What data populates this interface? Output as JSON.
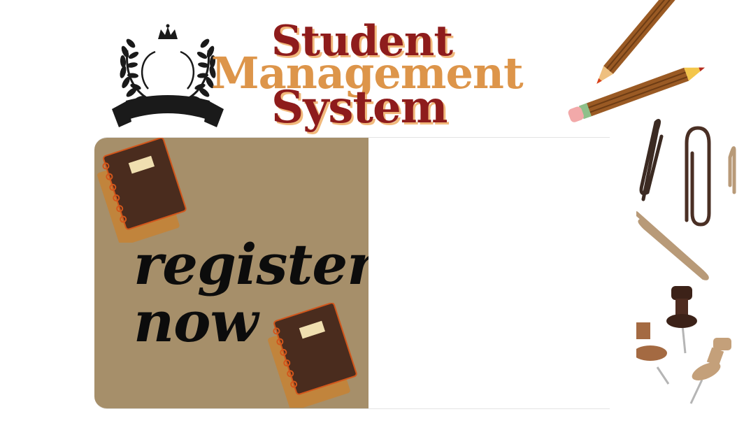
{
  "header": {
    "title_line1": "Student",
    "title_line2": "Management",
    "title_line3": "System"
  },
  "banner": {
    "line1": "register",
    "line2": "now"
  },
  "colors": {
    "title_dark": "#8e1c1c",
    "title_light": "#dd954a",
    "title_shadow": "#f1b97c",
    "banner_bg": "#a68f6a",
    "banner_text": "#0c0c0c",
    "book_cover": "#4a2c1e",
    "book_back": "#c1843c"
  },
  "icons": {
    "logo": "laurel-wreath-crown-icon",
    "pencils": "pencil-icon",
    "clips": "paper-clip-icon",
    "pins": "push-pin-icon",
    "notebook": "notebook-icon"
  }
}
